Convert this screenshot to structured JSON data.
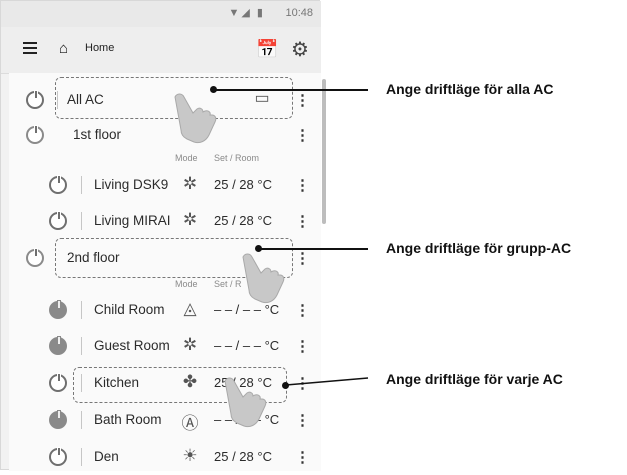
{
  "status_bar": {
    "time": "10:48",
    "icons": "▼◢ ▮"
  },
  "app_bar": {
    "menu_icon": "menu-icon",
    "home_label": "Home",
    "home_icon": "home-icon",
    "schedule_icon": "calendar-icon",
    "settings_icon": "gear-icon"
  },
  "column_headers": {
    "mode": "Mode",
    "set_room": "Set / Room",
    "set_room_partial": "Set / R"
  },
  "rows": [
    {
      "name": "All AC",
      "type": "all",
      "power": "off",
      "more": "⋮"
    },
    {
      "name": "1st floor",
      "type": "group",
      "power": "off",
      "more": "⋮"
    },
    {
      "name": "Living DSK9",
      "type": "unit",
      "power": "off",
      "mode": "heat",
      "mode_glyph": "✲",
      "temp": "25 / 28 °C",
      "more": "⋮"
    },
    {
      "name": "Living MIRAI",
      "type": "unit",
      "power": "off",
      "mode": "heat",
      "mode_glyph": "✲",
      "temp": "25 / 28 °C",
      "more": "⋮"
    },
    {
      "name": "2nd floor",
      "type": "group",
      "power": "off",
      "more": "⋮"
    },
    {
      "name": "Child Room",
      "type": "unit",
      "power": "on",
      "mode": "dry",
      "mode_glyph": "◬",
      "temp": "– – / – –  °C",
      "more": "⋮"
    },
    {
      "name": "Guest Room",
      "type": "unit",
      "power": "on",
      "mode": "heat",
      "mode_glyph": "✲",
      "temp": "– – / – –  °C",
      "more": "⋮"
    },
    {
      "name": "Kitchen",
      "type": "unit",
      "power": "off",
      "mode": "fan",
      "mode_glyph": "✤",
      "temp": "25 / 28 °C",
      "more": "⋮"
    },
    {
      "name": "Bath Room",
      "type": "unit",
      "power": "on",
      "mode": "auto",
      "mode_glyph": "Ⓐ",
      "temp": "– – / – –  °C",
      "more": "⋮"
    },
    {
      "name": "Den",
      "type": "unit",
      "power": "off",
      "mode": "sun",
      "mode_glyph": "☀",
      "temp": "25 / 28 °C",
      "more": "⋮"
    }
  ],
  "callouts": {
    "all": "Ange driftläge för alla AC",
    "group": "Ange driftläge för grupp-AC",
    "each": "Ange driftläge för varje AC"
  },
  "colors": {
    "accent": "#111111",
    "power_on": "#8a8a8a",
    "text": "#2b2b2b"
  }
}
